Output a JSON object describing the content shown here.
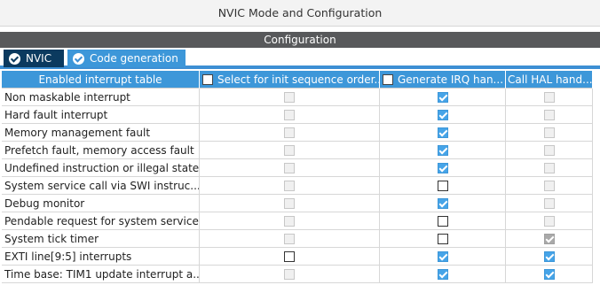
{
  "window": {
    "title": "NVIC Mode and Configuration"
  },
  "config_header": "Configuration",
  "tabs": [
    {
      "label": "NVIC",
      "selected": false
    },
    {
      "label": "Code generation",
      "selected": true
    }
  ],
  "colors": {
    "accent": "#3d97d9",
    "tab_dark": "#0b3a5f",
    "header_gray": "#58595b"
  },
  "table": {
    "columns": [
      "Enabled interrupt table",
      "Select for init sequence order...",
      "Generate IRQ han...",
      "Call HAL hand..."
    ],
    "rows": [
      {
        "name": "Non maskable interrupt",
        "c1": "off-dis",
        "c2": "on-en",
        "c3": "off-dis"
      },
      {
        "name": "Hard fault interrupt",
        "c1": "off-dis",
        "c2": "on-en",
        "c3": "off-dis"
      },
      {
        "name": "Memory management fault",
        "c1": "off-dis",
        "c2": "on-en",
        "c3": "off-dis"
      },
      {
        "name": "Prefetch fault, memory access fault",
        "c1": "off-dis",
        "c2": "on-en",
        "c3": "off-dis"
      },
      {
        "name": "Undefined instruction or illegal state",
        "c1": "off-dis",
        "c2": "on-en",
        "c3": "off-dis"
      },
      {
        "name": "System service call via SWI instruc...",
        "c1": "off-dis",
        "c2": "off-en",
        "c3": "off-dis"
      },
      {
        "name": "Debug monitor",
        "c1": "off-dis",
        "c2": "on-en",
        "c3": "off-dis"
      },
      {
        "name": "Pendable request for system service",
        "c1": "off-dis",
        "c2": "off-en",
        "c3": "off-dis"
      },
      {
        "name": "System tick timer",
        "c1": "off-dis",
        "c2": "off-en",
        "c3": "on-dis"
      },
      {
        "name": "EXTI line[9:5] interrupts",
        "c1": "off-en",
        "c2": "on-en",
        "c3": "on-en"
      },
      {
        "name": "Time base: TIM1 update interrupt a...",
        "c1": "off-dis",
        "c2": "on-en",
        "c3": "on-en"
      }
    ]
  }
}
